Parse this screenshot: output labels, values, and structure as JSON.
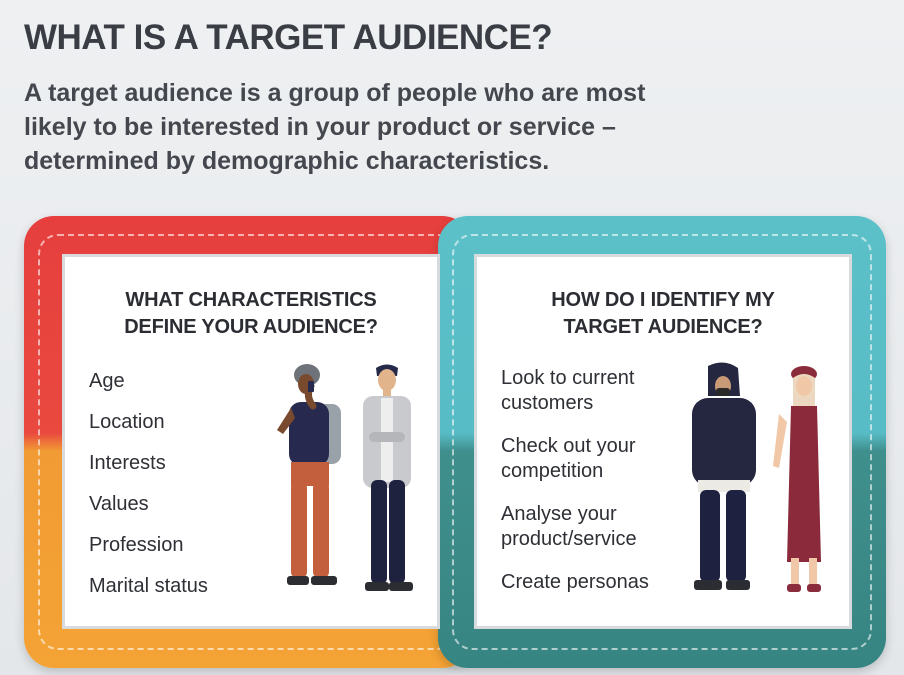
{
  "header": {
    "title": "WHAT IS A TARGET AUDIENCE?",
    "intro_line1": "A target audience is a group of people who are most",
    "intro_line2": "likely to be interested in your product or service –",
    "intro_line3": "determined by demographic characteristics."
  },
  "left_card": {
    "title_line1": "WHAT CHARACTERISTICS",
    "title_line2": "DEFINE YOUR AUDIENCE?",
    "items": [
      "Age",
      "Location",
      "Interests",
      "Values",
      "Profession",
      "Marital status"
    ]
  },
  "right_card": {
    "title_line1": "HOW DO I IDENTIFY MY",
    "title_line2": "TARGET AUDIENCE?",
    "items": [
      {
        "line1": "Look to current",
        "line2": "customers"
      },
      {
        "line1": "Check out your",
        "line2": "competition"
      },
      {
        "line1": "Analyse your",
        "line2": "product/service"
      },
      {
        "line1": "Create personas",
        "line2": ""
      }
    ]
  },
  "colors": {
    "red": "#e63f3e",
    "orange": "#f4a335",
    "teal_light": "#5cc0c9",
    "teal_dark": "#378582",
    "text_dark": "#3a3d44"
  },
  "illustrations": [
    "person-with-phone-illustration",
    "man-in-blazer-illustration",
    "person-in-hoodie-illustration",
    "woman-in-dress-illustration"
  ]
}
